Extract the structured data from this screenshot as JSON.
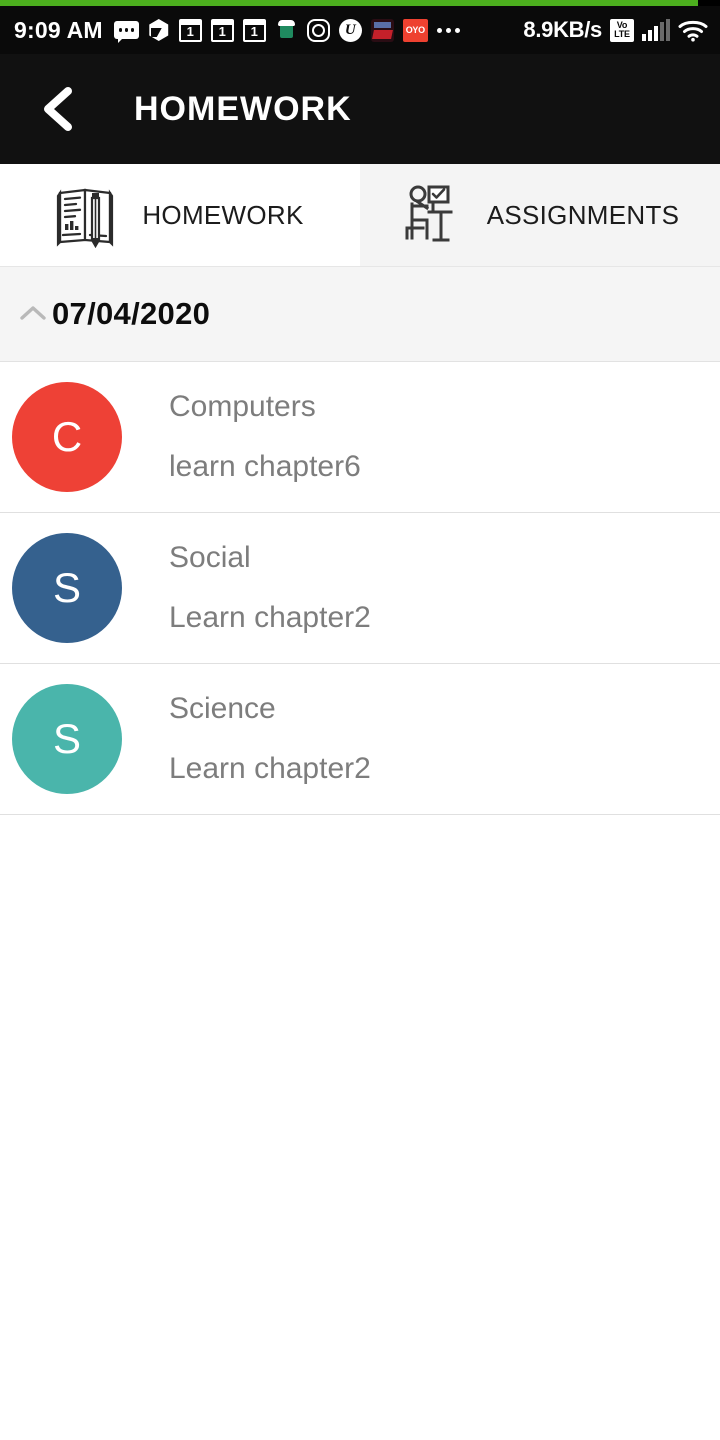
{
  "status_bar": {
    "time": "9:09 AM",
    "network_speed": "8.9KB/s",
    "volte_top": "Vo",
    "volte_bottom": "LTE",
    "oyo_label": "OYO",
    "uc_label": "U",
    "left_icons": [
      {
        "name": "sms-icon",
        "label": "sms"
      },
      {
        "name": "drive-icon",
        "label": "drive"
      },
      {
        "name": "calendar-icon-1",
        "label": "1"
      },
      {
        "name": "calendar-icon-2",
        "label": "1"
      },
      {
        "name": "calendar-icon-3",
        "label": "1"
      },
      {
        "name": "school-app-icon",
        "label": "school"
      },
      {
        "name": "instagram-icon",
        "label": "instagram"
      },
      {
        "name": "uc-browser-icon",
        "label": "uc browser"
      },
      {
        "name": "red-media-app-icon",
        "label": "media"
      },
      {
        "name": "oyo-icon",
        "label": "OYO"
      },
      {
        "name": "more-notifications-icon",
        "label": "more"
      }
    ],
    "right_icons": [
      {
        "name": "volte-icon",
        "label": "VoLTE"
      },
      {
        "name": "signal-bars-icon",
        "label": "signal"
      },
      {
        "name": "wifi-icon",
        "label": "wifi"
      }
    ]
  },
  "accent": {
    "progress_color": "#4CAF1E",
    "progress_percent": 97
  },
  "app_bar": {
    "title": "HOMEWORK",
    "back_icon": "chevron-left-icon",
    "background_color": "#111111",
    "title_color": "#FFFFFF"
  },
  "tabs": [
    {
      "id": "homework",
      "label": "HOMEWORK",
      "icon": "book-pencil-icon",
      "active": true
    },
    {
      "id": "assignments",
      "label": "ASSIGNMENTS",
      "icon": "student-desk-icon",
      "active": false
    }
  ],
  "date_group": {
    "date": "07/04/2020",
    "chevron_icon": "chevron-up-icon",
    "expanded": true
  },
  "homework_items": [
    {
      "initial": "C",
      "subject": "Computers",
      "task": "learn chapter6",
      "avatar_color": "#EE4136"
    },
    {
      "initial": "S",
      "subject": "Social",
      "task": "Learn chapter2",
      "avatar_color": "#35618E"
    },
    {
      "initial": "S",
      "subject": "Science",
      "task": "Learn chapter2",
      "avatar_color": "#4AB5AB"
    }
  ]
}
